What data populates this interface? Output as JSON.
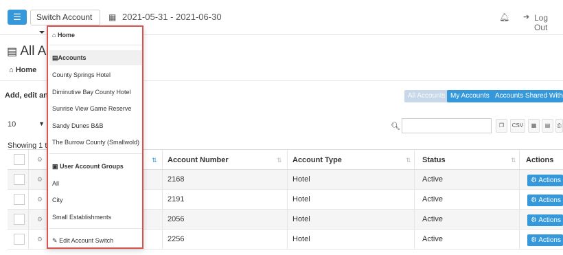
{
  "topbar": {
    "menu_icon": "☰",
    "switch_label": "Switch Account",
    "date_range": "2021-05-31 - 2021-06-30",
    "logout": "Log Out"
  },
  "page": {
    "title": "All A",
    "breadcrumb": "Home",
    "intro": "Add, edit an"
  },
  "filters": {
    "all": "All Accounts",
    "my": "My Accounts",
    "shared": "Accounts Shared With Me"
  },
  "controls": {
    "length": "10",
    "showing": "Showing 1 t",
    "tools": [
      "CSV"
    ]
  },
  "table": {
    "headers": [
      "Account Number",
      "Account Type",
      "Status",
      "Actions"
    ],
    "rows": [
      {
        "number": "2168",
        "type": "Hotel",
        "status": "Active",
        "action": "Actions"
      },
      {
        "number": "2191",
        "type": "Hotel",
        "status": "Active",
        "action": "Actions"
      },
      {
        "number": "2056",
        "type": "Hotel",
        "status": "Active",
        "action": "Actions"
      },
      {
        "number": "2256",
        "type": "Hotel",
        "status": "Active",
        "action": "Actions"
      }
    ]
  },
  "dropdown": {
    "home": "Home",
    "accounts_header": "Accounts",
    "accounts": [
      "County Springs Hotel",
      "Diminutive Bay County Hotel",
      "Sunrise View Game Reserve",
      "Sandy Dunes B&B",
      "The Burrow County (Smallwold)"
    ],
    "groups_header": "User Account Groups",
    "groups": [
      "All",
      "City",
      "Small Establishments"
    ],
    "edit": "Edit Account Switch"
  },
  "colors": {
    "primary": "#3498db",
    "highlight_border": "#d9534f"
  }
}
